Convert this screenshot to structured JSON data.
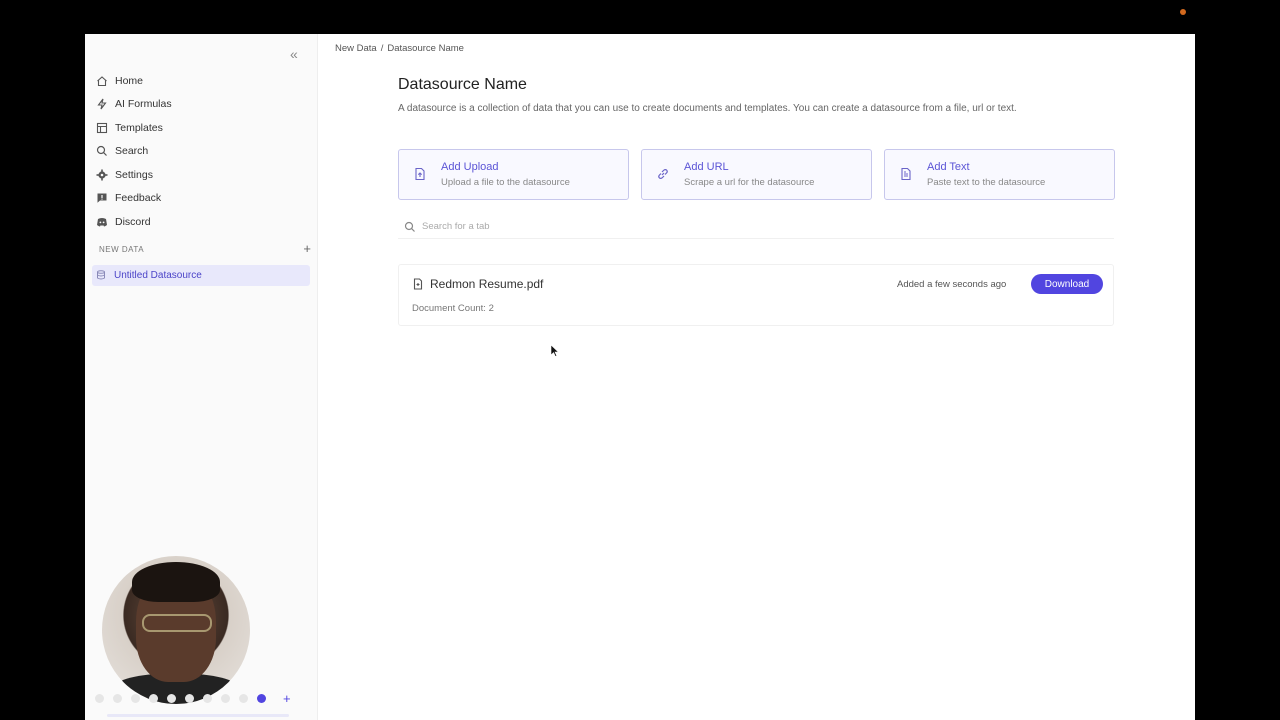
{
  "sidebar": {
    "collapse_icon": "double-chevron-left-icon",
    "items": [
      {
        "label": "Home",
        "icon": "home-icon"
      },
      {
        "label": "AI Formulas",
        "icon": "lightning-icon"
      },
      {
        "label": "Templates",
        "icon": "templates-icon"
      },
      {
        "label": "Search",
        "icon": "search-icon"
      },
      {
        "label": "Settings",
        "icon": "gear-icon"
      },
      {
        "label": "Feedback",
        "icon": "feedback-icon"
      },
      {
        "label": "Discord",
        "icon": "discord-icon"
      }
    ],
    "section_title": "NEW DATA",
    "section_add": "+",
    "datasource": "Untitled Datasource",
    "dots_add": "+"
  },
  "breadcrumb": {
    "parent": "New Data",
    "separator": "/",
    "current": "Datasource Name"
  },
  "main": {
    "title": "Datasource Name",
    "description": "A datasource is a collection of data that you can use to create documents and templates. You can create a datasource from a file, url or text.",
    "cards": [
      {
        "title": "Add Upload",
        "subtitle": "Upload a file to the datasource",
        "icon": "file-upload-icon"
      },
      {
        "title": "Add URL",
        "subtitle": "Scrape a url for the datasource",
        "icon": "link-icon"
      },
      {
        "title": "Add Text",
        "subtitle": "Paste text to the datasource",
        "icon": "document-text-icon"
      }
    ],
    "search_placeholder": "Search for a tab",
    "file": {
      "name": "Redmon Resume.pdf",
      "count_label": "Document Count: 2",
      "added": "Added a few seconds ago",
      "download_label": "Download"
    }
  },
  "colors": {
    "accent": "#5145e0",
    "selected_bg": "#e8e8fb",
    "card_border": "#c7c7ec"
  }
}
